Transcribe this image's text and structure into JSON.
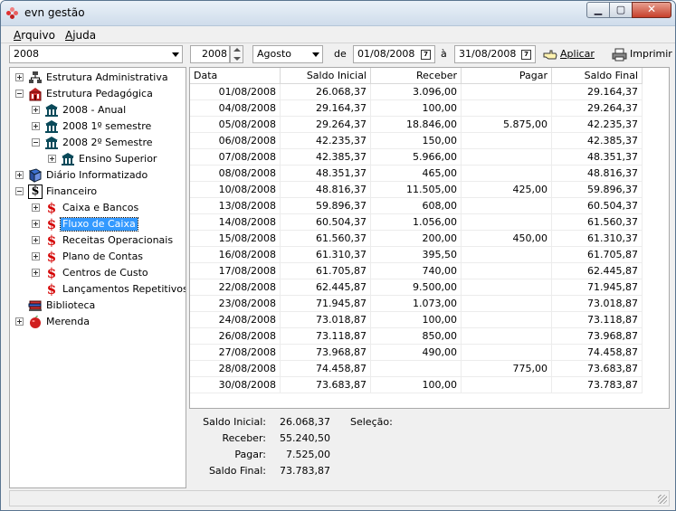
{
  "window": {
    "title": "evn gestão"
  },
  "menu": {
    "items": [
      "Arquivo",
      "Ajuda"
    ]
  },
  "toolbar": {
    "period_select": "2008",
    "year_value": "2008",
    "month_select": "Agosto",
    "from_label": "de",
    "from_date": "01/08/2008",
    "to_label": "à",
    "to_date": "31/08/2008",
    "apply_label": "Aplicar",
    "print_label": "Imprimir"
  },
  "tree": {
    "nodes": [
      {
        "label": "Estrutura Administrativa",
        "icon": "org-chart-icon",
        "expander": "plus",
        "level": 0
      },
      {
        "label": "Estrutura Pedagógica",
        "icon": "school-building-icon",
        "expander": "minus",
        "level": 0
      },
      {
        "label": "2008 - Anual",
        "icon": "bank-building-icon",
        "expander": "plus",
        "level": 1
      },
      {
        "label": "2008 1º semestre",
        "icon": "bank-building-icon",
        "expander": "plus",
        "level": 1
      },
      {
        "label": "2008 2º Semestre",
        "icon": "bank-building-icon",
        "expander": "minus",
        "level": 1
      },
      {
        "label": "Ensino Superior",
        "icon": "bank-building-icon",
        "expander": "plus",
        "level": 2
      },
      {
        "label": "Diário Informatizado",
        "icon": "book-icon",
        "expander": "plus",
        "level": 0
      },
      {
        "label": "Financeiro",
        "icon": "dollar-box-icon",
        "expander": "minus",
        "level": 0
      },
      {
        "label": "Caixa e Bancos",
        "icon": "dollar-icon",
        "expander": "plus",
        "level": 1
      },
      {
        "label": "Fluxo de Caixa",
        "icon": "dollar-icon",
        "expander": "plus",
        "level": 1,
        "selected": true
      },
      {
        "label": "Receitas Operacionais",
        "icon": "dollar-icon",
        "expander": "plus",
        "level": 1
      },
      {
        "label": "Plano de Contas",
        "icon": "dollar-icon",
        "expander": "plus",
        "level": 1
      },
      {
        "label": "Centros de Custo",
        "icon": "dollar-icon",
        "expander": "plus",
        "level": 1
      },
      {
        "label": "Lançamentos Repetitivos",
        "icon": "dollar-icon",
        "expander": "none",
        "level": 1
      },
      {
        "label": "Biblioteca",
        "icon": "books-icon",
        "expander": "none",
        "level": 0
      },
      {
        "label": "Merenda",
        "icon": "apple-icon",
        "expander": "plus",
        "level": 0
      }
    ]
  },
  "table": {
    "columns": [
      "Data",
      "Saldo Inicial",
      "Receber",
      "Pagar",
      "Saldo Final"
    ],
    "rows": [
      [
        "01/08/2008",
        "26.068,37",
        "3.096,00",
        "",
        "29.164,37"
      ],
      [
        "04/08/2008",
        "29.164,37",
        "100,00",
        "",
        "29.264,37"
      ],
      [
        "05/08/2008",
        "29.264,37",
        "18.846,00",
        "5.875,00",
        "42.235,37"
      ],
      [
        "06/08/2008",
        "42.235,37",
        "150,00",
        "",
        "42.385,37"
      ],
      [
        "07/08/2008",
        "42.385,37",
        "5.966,00",
        "",
        "48.351,37"
      ],
      [
        "08/08/2008",
        "48.351,37",
        "465,00",
        "",
        "48.816,37"
      ],
      [
        "10/08/2008",
        "48.816,37",
        "11.505,00",
        "425,00",
        "59.896,37"
      ],
      [
        "13/08/2008",
        "59.896,37",
        "608,00",
        "",
        "60.504,37"
      ],
      [
        "14/08/2008",
        "60.504,37",
        "1.056,00",
        "",
        "61.560,37"
      ],
      [
        "15/08/2008",
        "61.560,37",
        "200,00",
        "450,00",
        "61.310,37"
      ],
      [
        "16/08/2008",
        "61.310,37",
        "395,50",
        "",
        "61.705,87"
      ],
      [
        "17/08/2008",
        "61.705,87",
        "740,00",
        "",
        "62.445,87"
      ],
      [
        "22/08/2008",
        "62.445,87",
        "9.500,00",
        "",
        "71.945,87"
      ],
      [
        "23/08/2008",
        "71.945,87",
        "1.073,00",
        "",
        "73.018,87"
      ],
      [
        "24/08/2008",
        "73.018,87",
        "100,00",
        "",
        "73.118,87"
      ],
      [
        "26/08/2008",
        "73.118,87",
        "850,00",
        "",
        "73.968,87"
      ],
      [
        "27/08/2008",
        "73.968,87",
        "490,00",
        "",
        "74.458,87"
      ],
      [
        "28/08/2008",
        "74.458,87",
        "",
        "775,00",
        "73.683,87"
      ],
      [
        "30/08/2008",
        "73.683,87",
        "100,00",
        "",
        "73.783,87"
      ]
    ]
  },
  "summary": {
    "saldo_inicial_label": "Saldo Inicial:",
    "saldo_inicial": "26.068,37",
    "receber_label": "Receber:",
    "receber": "55.240,50",
    "pagar_label": "Pagar:",
    "pagar": "7.525,00",
    "saldo_final_label": "Saldo Final:",
    "saldo_final": "73.783,87",
    "selecao_label": "Seleção:"
  },
  "colors": {
    "selection": "#3399ff",
    "dollar": "#d40000"
  }
}
